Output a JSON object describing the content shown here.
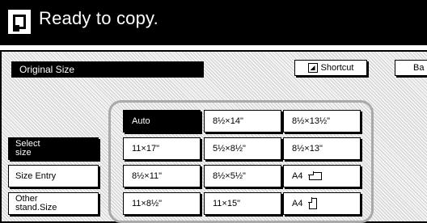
{
  "header": {
    "title": "Ready to copy."
  },
  "toolbar": {
    "section_label": "Original Size",
    "shortcut_label": "Shortcut",
    "back_label": "Ba"
  },
  "sidebar": {
    "items": [
      {
        "label_line1": "Select",
        "label_line2": "size",
        "active": true
      },
      {
        "label_line1": "Size Entry",
        "label_line2": "",
        "active": false
      },
      {
        "label_line1": "Other",
        "label_line2": "stand.Size",
        "active": false
      }
    ]
  },
  "sizes": {
    "r0c0": "Auto",
    "r0c1": "8½×14\"",
    "r0c2": "8½×13½\"",
    "r1c0": "11×17\"",
    "r1c1": "5½×8½\"",
    "r1c2": "8½×13\"",
    "r2c0": "8½×11\"",
    "r2c1": "8½×5½\"",
    "r2c2": "A4",
    "r3c0": "11×8½\"",
    "r3c1": "11×15\"",
    "r3c2": "A4"
  },
  "icons": {
    "a4_landscape": "landscape-orientation-icon",
    "a4_portrait": "portrait-orientation-icon",
    "shortcut": "shortcut-icon",
    "status": "document-icon"
  }
}
